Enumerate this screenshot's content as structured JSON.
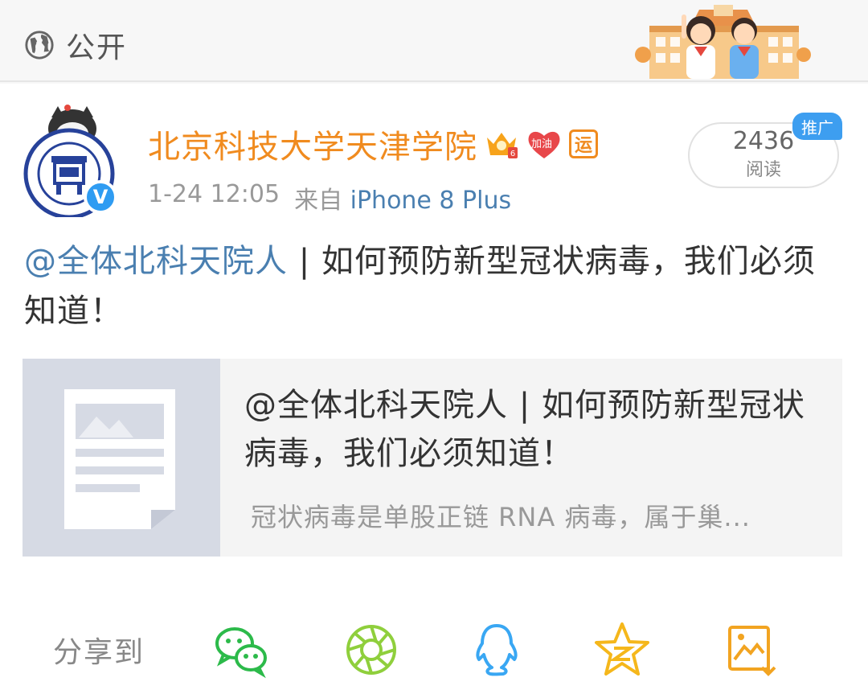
{
  "header": {
    "visibility_icon": "globe-icon",
    "visibility_label": "公开",
    "decoration_icon": "school-children-illustration"
  },
  "post": {
    "author": {
      "name": "北京科技大学天津学院",
      "avatar_icon": "university-seal-avatar",
      "verified_icon": "verified-v-badge",
      "badges": [
        "vip-crown-icon",
        "cheer-heart-icon",
        "yun-badge-icon"
      ],
      "cheer_text": "加油",
      "yun_text": "运"
    },
    "time": "1-24 12:05",
    "source_prefix": "来自",
    "device": "iPhone 8 Plus",
    "reads": {
      "count": "2436",
      "label": "阅读"
    },
    "promo_tag": "推广",
    "mention": "@全体北科天院人",
    "text": " | 如何预防新型冠状病毒，我们必须知道！",
    "link_card": {
      "thumb_icon": "article-document-icon",
      "title": "@全体北科天院人 | 如何预防新型冠状病毒，我们必须知道！",
      "description": "冠状病毒是单股正链 RNA 病毒，属于巢..."
    }
  },
  "share": {
    "label": "分享到",
    "targets": [
      {
        "icon": "wechat-icon",
        "color": "#2cba4a"
      },
      {
        "icon": "moments-icon",
        "color": "#8fcf3c"
      },
      {
        "icon": "qq-icon",
        "color": "#39a7f3"
      },
      {
        "icon": "qzone-icon",
        "color": "#f5b71b"
      },
      {
        "icon": "save-image-icon",
        "color": "#f2a421"
      }
    ]
  }
}
